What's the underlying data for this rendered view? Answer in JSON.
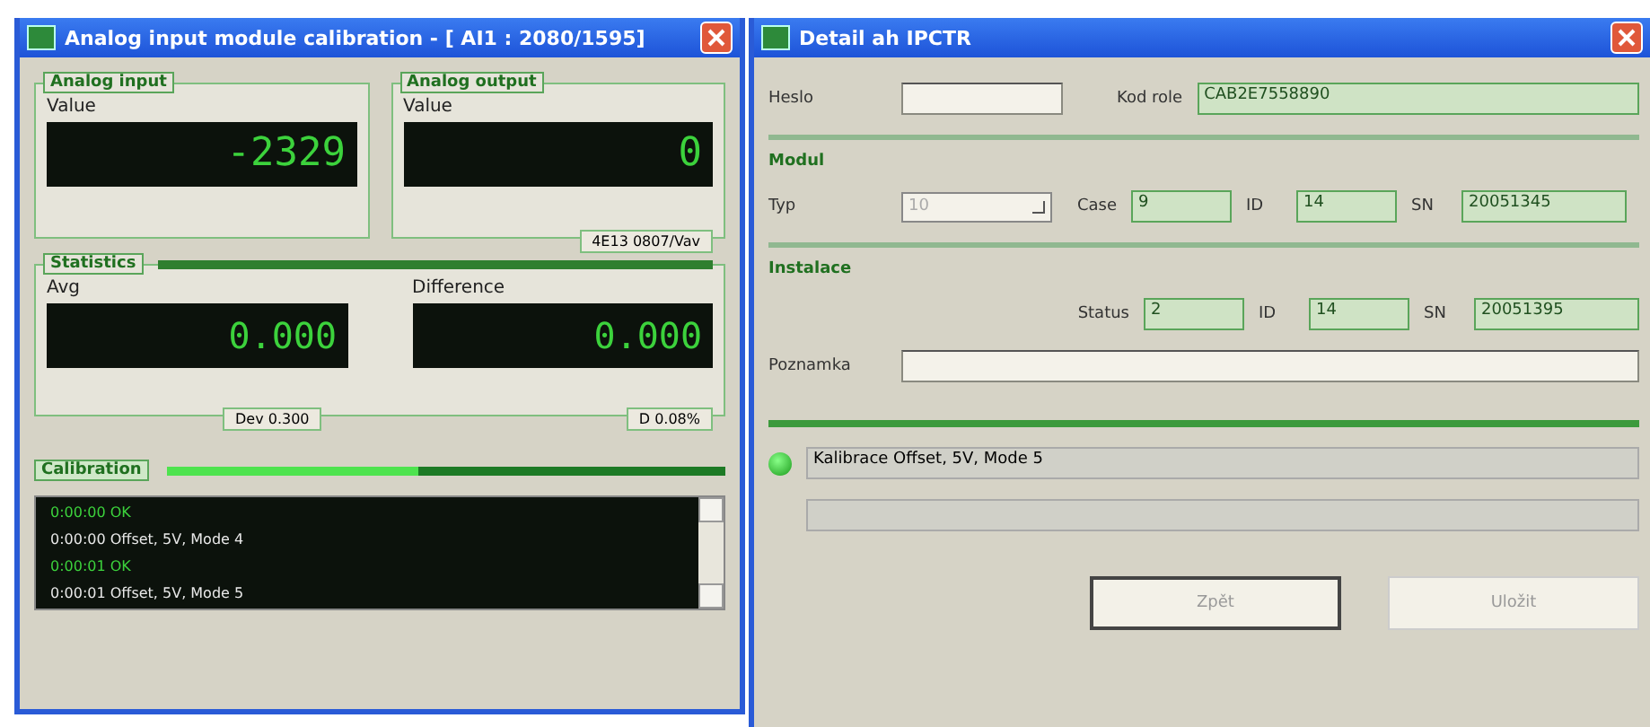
{
  "left_window": {
    "title": "Analog input module calibration - [ AI1 : 2080/1595]",
    "analog_input": {
      "legend": "Analog input",
      "label": "Value",
      "value": "-2329"
    },
    "analog_output": {
      "legend": "Analog output",
      "label": "Value",
      "value": "0",
      "badge": "4E13 0807/Vav"
    },
    "statistics": {
      "legend": "Statistics",
      "level": 1.0,
      "avg": {
        "label": "Avg",
        "value": "0.000"
      },
      "difference": {
        "label": "Difference",
        "value": "0.000"
      },
      "dev": "Dev 0.300",
      "percent": "D 0.08%"
    },
    "calibration": {
      "legend": "Calibration",
      "level": 0.45,
      "log": [
        {
          "text": "0:00:00 OK",
          "kind": "ok"
        },
        {
          "text": "0:00:00 Offset, 5V, Mode 4",
          "kind": "step"
        },
        {
          "text": "0:00:01 OK",
          "kind": "ok"
        },
        {
          "text": "0:00:01 Offset, 5V, Mode 5",
          "kind": "step"
        }
      ]
    }
  },
  "right_window": {
    "title": "Detail ah IPCTR",
    "heslo": {
      "label": "Heslo"
    },
    "kod": {
      "label": "Kod role",
      "value": "CAB2E7558890"
    },
    "modul": {
      "heading": "Modul",
      "typ": {
        "label": "Typ",
        "value": "10",
        "disabled": true
      },
      "fields": [
        {
          "label": "Case",
          "value": "9"
        },
        {
          "label": "ID",
          "value": "14"
        },
        {
          "label": "SN",
          "value": "20051345"
        }
      ]
    },
    "instalace": {
      "heading": "Instalace",
      "fields": [
        {
          "label": "Status",
          "value": "2"
        },
        {
          "label": "ID",
          "value": "14"
        },
        {
          "label": "SN",
          "value": "20051395"
        }
      ]
    },
    "poznamka": {
      "label": "Poznamka"
    },
    "status": {
      "lamp_on": true,
      "message": "Kalibrace Offset, 5V, Mode 5"
    },
    "buttons": [
      {
        "label": "Zpět",
        "focused": true
      },
      {
        "label": "Uložit",
        "focused": false
      }
    ]
  }
}
